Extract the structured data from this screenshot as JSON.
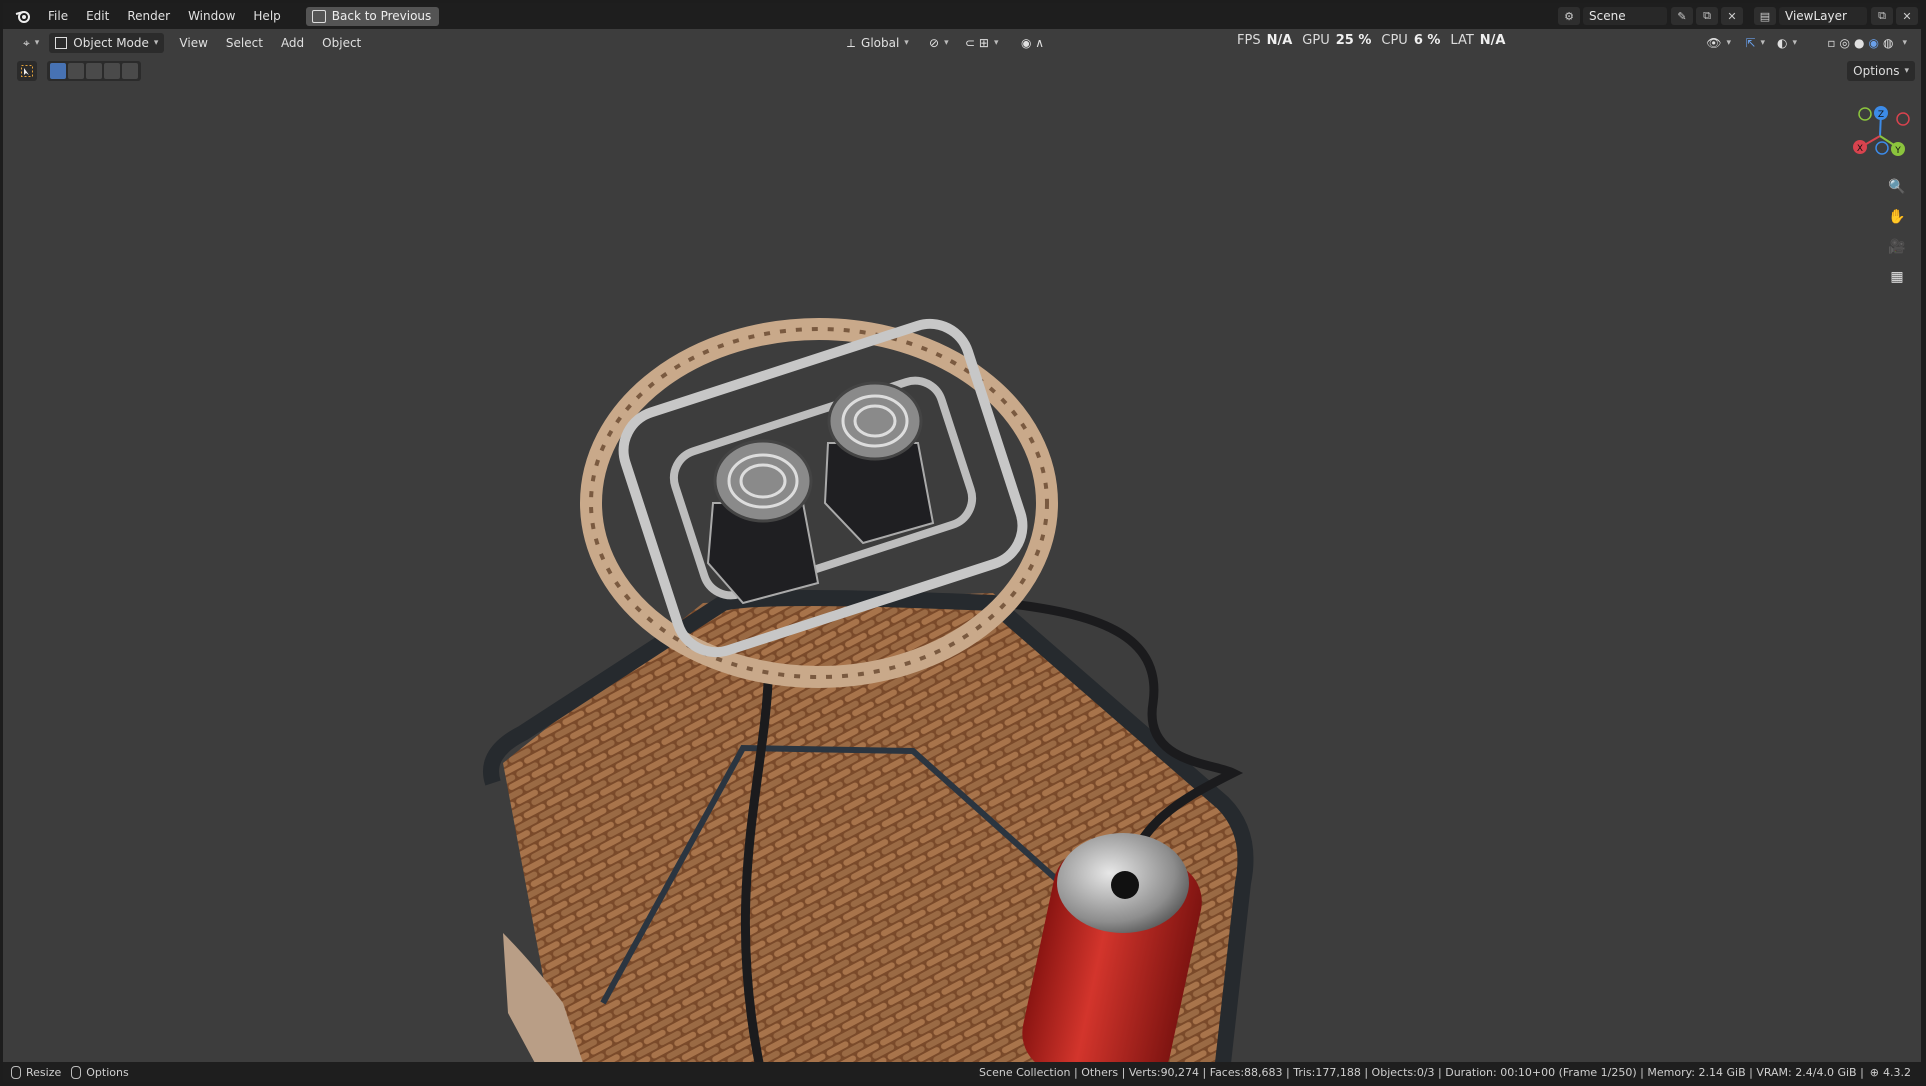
{
  "menu": [
    "File",
    "Edit",
    "Render",
    "Window",
    "Help"
  ],
  "back_button": "Back to Previous",
  "scene_field": "Scene",
  "viewlayer_field": "ViewLayer",
  "viewport": {
    "mode": "Object Mode",
    "menus": [
      "View",
      "Select",
      "Add",
      "Object"
    ],
    "orientation": "Global",
    "options": "Options"
  },
  "stats": {
    "fps_label": "FPS",
    "fps_value": "N/A",
    "gpu_label": "GPU",
    "gpu_value": "25 %",
    "cpu_label": "CPU",
    "cpu_value": "6 %",
    "lat_label": "LAT",
    "lat_value": "N/A"
  },
  "gizmo": {
    "x": "X",
    "y": "Y",
    "z": "Z"
  },
  "status": {
    "resize": "Resize",
    "options": "Options",
    "info": "Scene Collection | Others | Verts:90,274 | Faces:88,683 | Tris:177,188 | Objects:0/3 | Duration: 00:10+00 (Frame 1/250) | Memory: 2.14 GiB | VRAM: 2.4/4.0 GiB |",
    "version": "4.3.2"
  },
  "colors": {
    "accent": "#4772b3",
    "x_axis": "#d8434e",
    "y_axis": "#8bc43d",
    "z_axis": "#3c8be8"
  }
}
